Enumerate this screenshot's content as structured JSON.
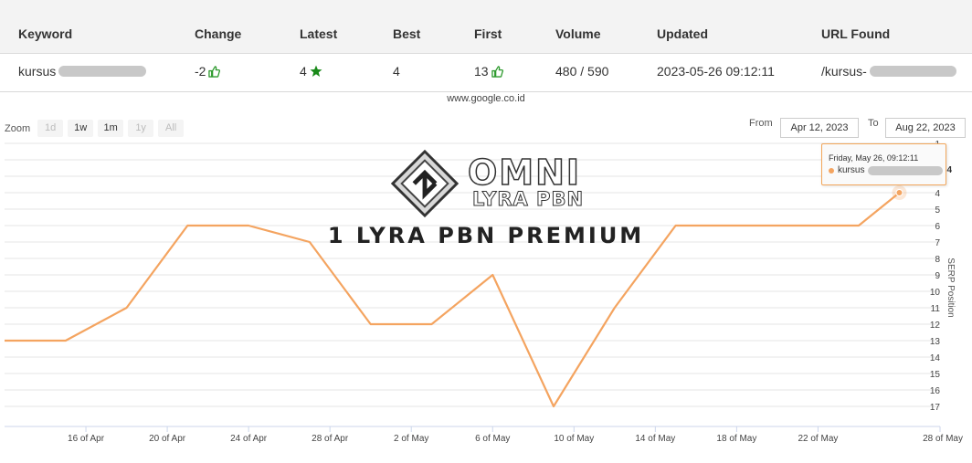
{
  "table": {
    "headers": {
      "keyword": "Keyword",
      "change": "Change",
      "latest": "Latest",
      "best": "Best",
      "first": "First",
      "volume": "Volume",
      "updated": "Updated",
      "url": "URL Found"
    },
    "row": {
      "keyword": "kursus",
      "change": "-2",
      "latest": "4",
      "best": "4",
      "first": "13",
      "volume": "480 / 590",
      "updated": "2023-05-26 09:12:11",
      "url": "/kursus-"
    }
  },
  "chart_header": {
    "source": "www.google.co.id"
  },
  "zoom": {
    "label": "Zoom",
    "buttons": [
      "1d",
      "1w",
      "1m",
      "1y",
      "All"
    ]
  },
  "range": {
    "from_label": "From",
    "from_value": "Apr 12, 2023",
    "to_label": "To",
    "to_value": "Aug 22, 2023"
  },
  "tooltip": {
    "date": "Friday, May 26, 09:12:11",
    "series": "kursus",
    "value": "4"
  },
  "watermark": {
    "name": "OMNI",
    "sub": "LYRA PBN",
    "tagline": "1 LYRA PBN PREMIUM"
  },
  "colors": {
    "series": "#f4a460",
    "up_icon": "#2e9a2e",
    "star": "#1a8a1a"
  },
  "icons": {
    "change": "thumb-up-icon",
    "latest": "star-icon",
    "first": "thumb-up-icon"
  },
  "chart_data": {
    "type": "line",
    "ylabel": "SERP Position",
    "y_reversed": true,
    "ylim": [
      1,
      17
    ],
    "yticks": [
      1,
      2,
      3,
      4,
      5,
      6,
      7,
      8,
      9,
      10,
      11,
      12,
      13,
      14,
      15,
      16,
      17
    ],
    "xticks": [
      "16 of Apr",
      "20 of Apr",
      "24 of Apr",
      "28 of Apr",
      "2 of May",
      "6 of May",
      "10 of May",
      "14 of May",
      "18 of May",
      "22 of May",
      "28 of May"
    ],
    "xlim": [
      "2023-04-12",
      "2023-05-28"
    ],
    "series": [
      {
        "name": "kursus",
        "points": [
          {
            "x": "2023-04-12",
            "y": 13
          },
          {
            "x": "2023-04-15",
            "y": 13
          },
          {
            "x": "2023-04-18",
            "y": 11
          },
          {
            "x": "2023-04-21",
            "y": 6
          },
          {
            "x": "2023-04-24",
            "y": 6
          },
          {
            "x": "2023-04-27",
            "y": 7
          },
          {
            "x": "2023-04-30",
            "y": 12
          },
          {
            "x": "2023-05-03",
            "y": 12
          },
          {
            "x": "2023-05-06",
            "y": 9
          },
          {
            "x": "2023-05-09",
            "y": 17
          },
          {
            "x": "2023-05-12",
            "y": 11
          },
          {
            "x": "2023-05-15",
            "y": 6
          },
          {
            "x": "2023-05-18",
            "y": 6
          },
          {
            "x": "2023-05-21",
            "y": 6
          },
          {
            "x": "2023-05-24",
            "y": 6
          },
          {
            "x": "2023-05-26",
            "y": 4
          }
        ]
      }
    ]
  }
}
